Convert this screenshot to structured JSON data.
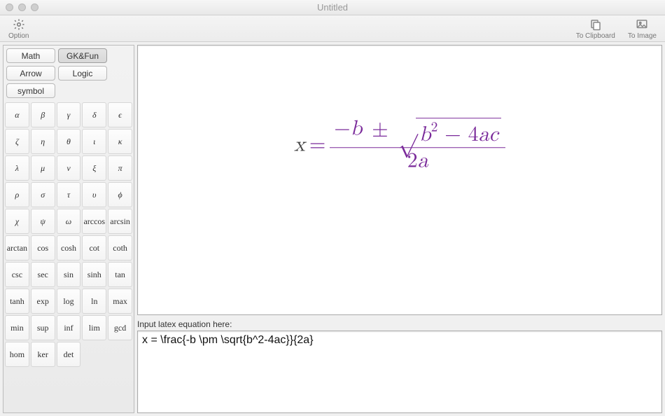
{
  "window": {
    "title": "Untitled"
  },
  "toolbar": {
    "option_label": "Option",
    "to_clipboard_label": "To Clipboard",
    "to_image_label": "To Image"
  },
  "categories": [
    {
      "label": "Math",
      "active": false
    },
    {
      "label": "GK&Fun",
      "active": true
    },
    {
      "label": "Arrow",
      "active": false
    },
    {
      "label": "Logic",
      "active": false
    },
    {
      "label": "symbol",
      "active": false
    }
  ],
  "symbols": [
    {
      "d": "α",
      "it": true
    },
    {
      "d": "β",
      "it": true
    },
    {
      "d": "γ",
      "it": true
    },
    {
      "d": "δ",
      "it": true
    },
    {
      "d": "ϵ",
      "it": true
    },
    {
      "d": "ζ",
      "it": true
    },
    {
      "d": "η",
      "it": true
    },
    {
      "d": "θ",
      "it": true
    },
    {
      "d": "ι",
      "it": true
    },
    {
      "d": "κ",
      "it": true
    },
    {
      "d": "λ",
      "it": true
    },
    {
      "d": "μ",
      "it": true
    },
    {
      "d": "ν",
      "it": true
    },
    {
      "d": "ξ",
      "it": true
    },
    {
      "d": "π",
      "it": true
    },
    {
      "d": "ρ",
      "it": true
    },
    {
      "d": "σ",
      "it": true
    },
    {
      "d": "τ",
      "it": true
    },
    {
      "d": "υ",
      "it": true
    },
    {
      "d": "ϕ",
      "it": true
    },
    {
      "d": "χ",
      "it": true
    },
    {
      "d": "ψ",
      "it": true
    },
    {
      "d": "ω",
      "it": true
    },
    {
      "d": "arccos",
      "it": false
    },
    {
      "d": "arcsin",
      "it": false
    },
    {
      "d": "arctan",
      "it": false
    },
    {
      "d": "cos",
      "it": false
    },
    {
      "d": "cosh",
      "it": false
    },
    {
      "d": "cot",
      "it": false
    },
    {
      "d": "coth",
      "it": false
    },
    {
      "d": "csc",
      "it": false
    },
    {
      "d": "sec",
      "it": false
    },
    {
      "d": "sin",
      "it": false
    },
    {
      "d": "sinh",
      "it": false
    },
    {
      "d": "tan",
      "it": false
    },
    {
      "d": "tanh",
      "it": false
    },
    {
      "d": "exp",
      "it": false
    },
    {
      "d": "log",
      "it": false
    },
    {
      "d": "ln",
      "it": false
    },
    {
      "d": "max",
      "it": false
    },
    {
      "d": "min",
      "it": false
    },
    {
      "d": "sup",
      "it": false
    },
    {
      "d": "inf",
      "it": false
    },
    {
      "d": "lim",
      "it": false
    },
    {
      "d": "gcd",
      "it": false
    },
    {
      "d": "hom",
      "it": false
    },
    {
      "d": "ker",
      "it": false
    },
    {
      "d": "det",
      "it": false
    }
  ],
  "equation": {
    "lhs": "x",
    "eq_sign": "=",
    "num_minus": "−",
    "num_b": "b",
    "num_pm": "±",
    "rad_b": "b",
    "rad_sup": "2",
    "rad_minus": "−",
    "rad_4": "4",
    "rad_a": "a",
    "rad_c": "c",
    "den_2": "2",
    "den_a": "a",
    "color_body": "#7a2a9a",
    "color_lhs": "#424242"
  },
  "input": {
    "label": "Input latex equation here:",
    "value": "x = \\frac{-b \\pm \\sqrt{b^2-4ac}}{2a}"
  },
  "icons": {
    "gear": "gear-icon",
    "clipboard": "clipboard-icon",
    "image": "image-icon"
  }
}
